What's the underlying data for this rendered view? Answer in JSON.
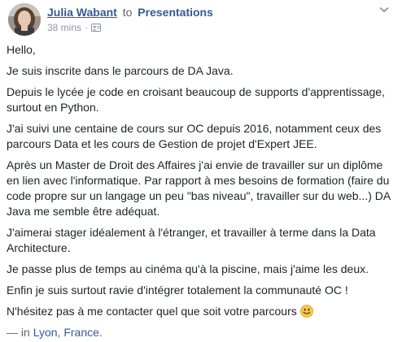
{
  "post": {
    "author": "Julia Wabant",
    "to_text": "to",
    "group": "Presentations",
    "timestamp": "38 mins",
    "dot": "·",
    "privacy_icon": "friends-icon",
    "menu_icon": "chevron-down-icon",
    "paragraphs": [
      "Hello,",
      "Je suis inscrite dans le parcours de DA Java.",
      "Depuis le lycée je code en croisant beaucoup de supports d'apprentissage, surtout en Python.",
      "J'ai suivi une centaine de cours sur OC depuis 2016, notamment ceux des parcours Data et les cours de Gestion de projet d'Expert JEE.",
      "Après un Master de Droit des Affaires j'ai envie de travailler sur un diplôme en lien avec l'informatique. Par rapport à mes besoins de formation (faire du code propre sur un langage un peu \"bas niveau\", travailler sur du web...) DA Java me semble être adéquat.",
      "J'aimerai stager idéalement à l'étranger, et travailler à terme dans la Data Architecture.",
      "Je passe plus de temps au cinéma qu'à la piscine, mais j'aime les deux.",
      "Enfin je suis surtout ravie d'intégrer totalement la communauté OC !",
      "N'hésitez pas à me contacter quel que soit votre parcours"
    ],
    "emoji": "smiley-emoji",
    "location_prefix": "— in",
    "location_city": "Lyon",
    "location_sep": ",",
    "location_country": "France",
    "location_end": "."
  },
  "colors": {
    "link": "#365899",
    "text": "#1d2129",
    "meta": "#90949c",
    "emoji": "#f7c948"
  }
}
